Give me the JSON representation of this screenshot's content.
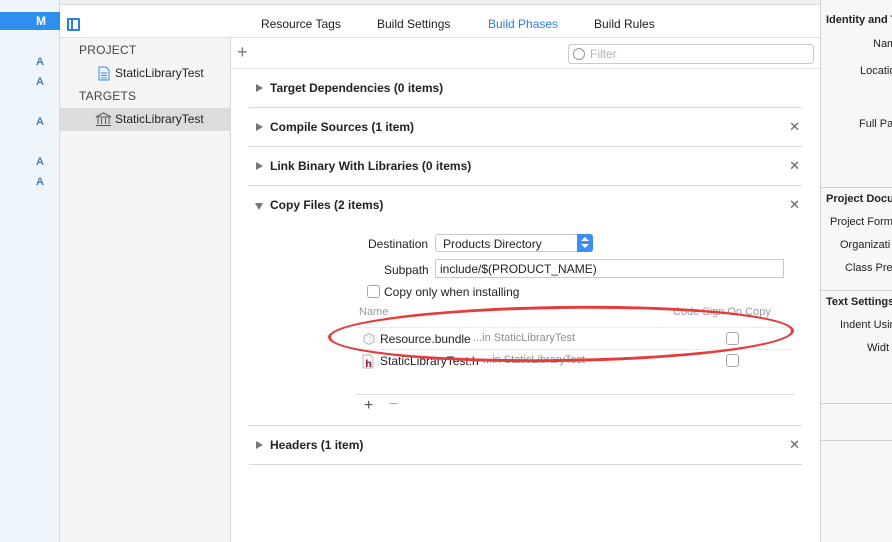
{
  "left_column": {
    "selected_marker": "M",
    "markers": [
      "A",
      "A",
      "A",
      "A",
      "A"
    ]
  },
  "tabs": [
    {
      "label": "Resource Tags",
      "active": false
    },
    {
      "label": "Build Settings",
      "active": false
    },
    {
      "label": "Build Phases",
      "active": true
    },
    {
      "label": "Build Rules",
      "active": false
    }
  ],
  "sidebar": {
    "project_header": "PROJECT",
    "project_item": "StaticLibraryTest",
    "targets_header": "TARGETS",
    "target_item": "StaticLibraryTest"
  },
  "filter": {
    "placeholder": "Filter"
  },
  "phases": {
    "target_dependencies": "Target Dependencies (0 items)",
    "compile_sources": "Compile Sources (1 item)",
    "link_binary": "Link Binary With Libraries (0 items)",
    "copy_files": "Copy Files (2 items)",
    "headers": "Headers (1 item)"
  },
  "copy_files": {
    "destination_label": "Destination",
    "destination_value": "Products Directory",
    "subpath_label": "Subpath",
    "subpath_value": "include/$(PRODUCT_NAME)",
    "copy_only_label": "Copy only when installing",
    "col_name": "Name",
    "col_code_sign": "Code Sign On Copy",
    "files": [
      {
        "name": "Resource.bundle",
        "location": "...in StaticLibraryTest"
      },
      {
        "name": "StaticLibraryTest.h",
        "location": "...in StaticLibraryTest"
      }
    ]
  },
  "inspector": {
    "identity_header": "Identity and T",
    "name_label": "Nam",
    "location_label": "Locatio",
    "full_path_label": "Full Pat",
    "project_doc_header": "Project Docu",
    "project_format_label": "Project Form",
    "organization_label": "Organizati",
    "class_prefix_label": "Class Pref",
    "text_settings_header": "Text Settings",
    "indent_label": "Indent Usin",
    "width_label": "Widt"
  },
  "colors": {
    "accent": "#2a7fe3",
    "annotation": "#e43c3c",
    "selection": "#2f8ff0"
  }
}
